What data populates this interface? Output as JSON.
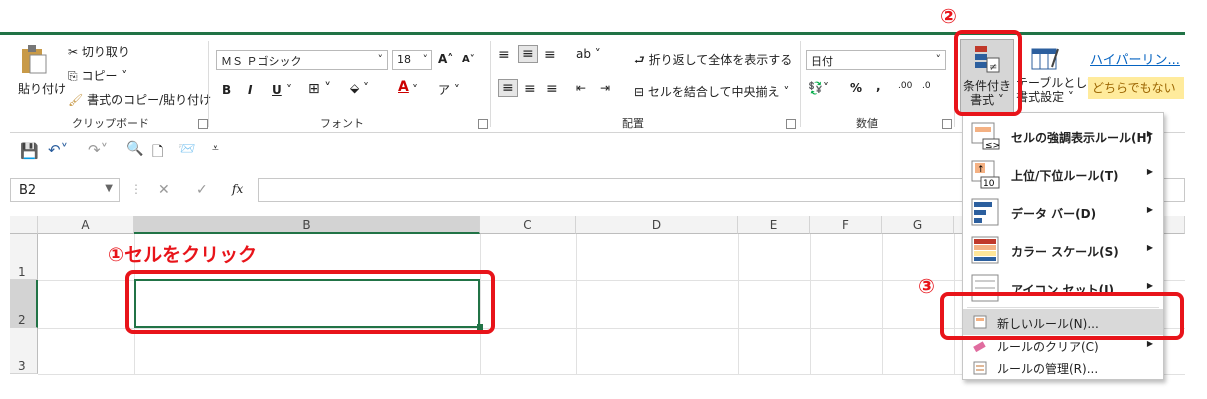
{
  "ribbon": {
    "clipboard": {
      "paste": "貼り付け",
      "cut": "切り取り",
      "copy": "コピー",
      "format_painter": "書式のコピー/貼り付け",
      "label": "クリップボード"
    },
    "font": {
      "name": "ＭＳ Ｐゴシック",
      "size": "18",
      "grow": "A",
      "shrink": "A",
      "bold": "B",
      "italic": "I",
      "underline": "U",
      "label": "フォント"
    },
    "alignment": {
      "wrap": "折り返して全体を表示する",
      "merge": "セルを結合して中央揃え",
      "label": "配置"
    },
    "number": {
      "format": "日付",
      "percent": "%",
      "comma": ",",
      "label": "数値"
    },
    "styles": {
      "conditional_1": "条件付き",
      "conditional_2": "書式",
      "table_1": "テーブルとして",
      "table_2": "書式設定",
      "hyperlink": "ハイパーリン...",
      "neutral": "どちらでもない"
    }
  },
  "formula_bar": {
    "name_box": "B2",
    "fx": "fx",
    "cancel": "✕",
    "enter": "✓"
  },
  "grid": {
    "columns": [
      "A",
      "B",
      "C",
      "D",
      "E",
      "F",
      "G"
    ],
    "rows": [
      "1",
      "2",
      "3"
    ]
  },
  "menu": {
    "items": [
      {
        "label": "セルの強調表示ルール(H)"
      },
      {
        "label": "上位/下位ルール(T)"
      },
      {
        "label": "データ バー(D)"
      },
      {
        "label": "カラー スケール(S)"
      },
      {
        "label": "アイコン セット(I)"
      },
      {
        "label": "新しいルール(N)..."
      },
      {
        "label": "ルールのクリア(C)"
      },
      {
        "label": "ルールの管理(R)..."
      }
    ]
  },
  "annotations": {
    "step1": "①セルをクリック",
    "step2": "②",
    "step3": "③",
    "color": "#e8141a"
  }
}
